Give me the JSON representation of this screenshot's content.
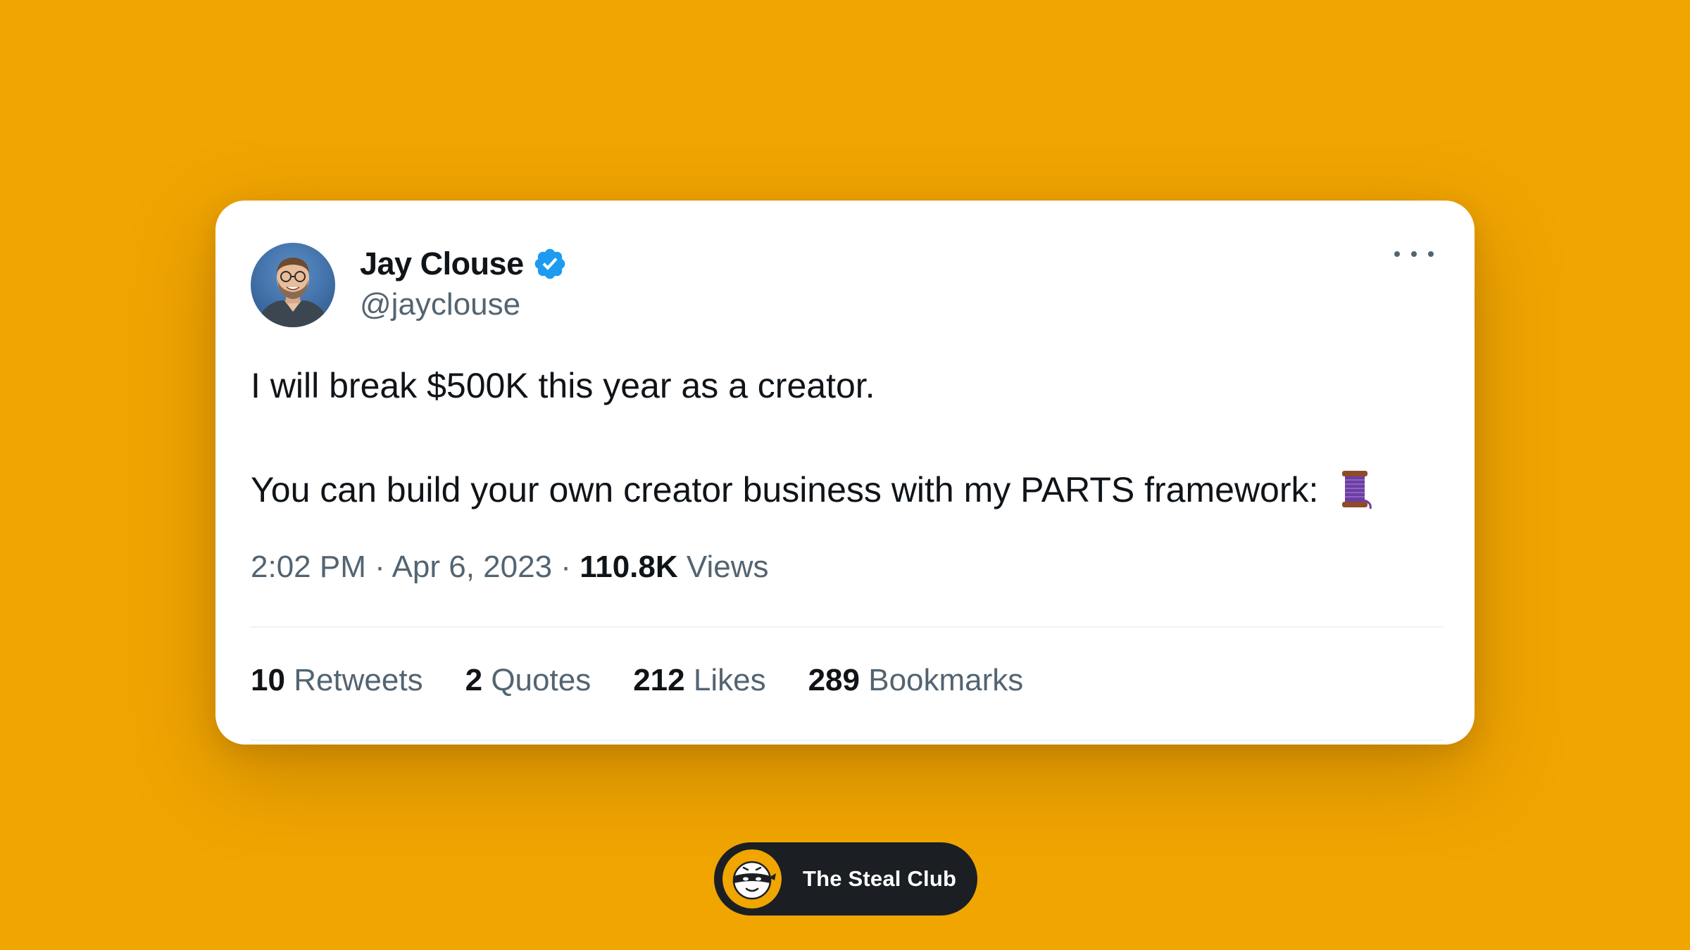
{
  "page": {
    "background_color": "#F0A500"
  },
  "tweet": {
    "author": {
      "display_name": "Jay Clouse",
      "handle": "@jayclouse",
      "verified": true,
      "verified_color": "#1D9BF0"
    },
    "text_line1": "I will break $500K this year as a creator.",
    "text_line2": "You can build your own creator business with my PARTS framework:",
    "text_emoji": "thread-spool-icon",
    "time": "2:02 PM",
    "separator": "·",
    "date": "Apr 6, 2023",
    "views_count": "110.8K",
    "views_label": "Views",
    "stats": [
      {
        "count": "10",
        "label": "Retweets"
      },
      {
        "count": "2",
        "label": "Quotes"
      },
      {
        "count": "212",
        "label": "Likes"
      },
      {
        "count": "289",
        "label": "Bookmarks"
      }
    ],
    "more_icon": "more-dots-icon"
  },
  "brand": {
    "name": "The Steal Club",
    "logo_icon": "masked-face-icon"
  },
  "colors": {
    "text_primary": "#0F1419",
    "text_secondary": "#536471",
    "card": "#FFFFFF",
    "pill": "#1B1F24"
  }
}
